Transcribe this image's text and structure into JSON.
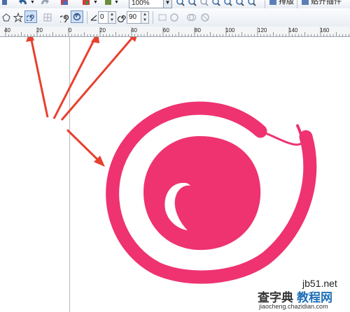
{
  "toolbar_top": {
    "zoom_value": "100%",
    "arrange_label": "排版",
    "snap_label": "贴齐插件"
  },
  "property_bar": {
    "spiral_revolutions_value": "0",
    "expansion_value": "90"
  },
  "ruler": {
    "labels": [
      "40",
      "20",
      "0",
      "20",
      "40",
      "60",
      "80",
      "100",
      "120",
      "140",
      "160"
    ]
  },
  "canvas": {
    "spiral_color": "#EE3370",
    "arrow_color": "#E8402E"
  },
  "watermark": {
    "line1": "查字典",
    "line2": "教程网",
    "line3": "jb51.net",
    "line4": "jiaocheng.chazidian.com"
  },
  "icons": {
    "undo": "undo-icon",
    "redo": "redo-icon",
    "import": "import-icon",
    "export": "export-icon",
    "zoom_in": "zoom-in-icon",
    "zoom_out": "zoom-out-icon",
    "symmetric_spiral": "symmetric-spiral-icon",
    "logarithmic_spiral": "logarithmic-spiral-icon",
    "revolutions": "revolutions-icon",
    "expansion": "expansion-icon"
  }
}
